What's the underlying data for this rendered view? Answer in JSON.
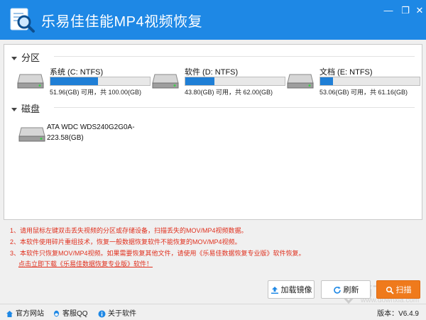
{
  "app": {
    "title": "乐易佳佳能MP4视频恢复",
    "minimize_glyph": "—",
    "restore_glyph": "❐",
    "close_glyph": "✕"
  },
  "partitions": {
    "header": "分区",
    "items": [
      {
        "name": "系统 (C: NTFS)",
        "usage": "51.96(GB) 可用，共 100.00(GB)",
        "used_fraction": 0.48
      },
      {
        "name": "软件 (D: NTFS)",
        "usage": "43.80(GB) 可用，共 62.00(GB)",
        "used_fraction": 0.29
      },
      {
        "name": "文档 (E: NTFS)",
        "usage": "53.06(GB) 可用，共 61.16(GB)",
        "used_fraction": 0.13
      }
    ]
  },
  "disks": {
    "header": "磁盘",
    "items": [
      {
        "name": "ATA WDC WDS240G2G0A-",
        "size": "223.58(GB)"
      }
    ]
  },
  "notes": [
    "1、请用鼠标左键双击丢失视频的分区或存储设备，扫描丢失的MOV/MP4视频数据。",
    "2、本软件使用碎片重组技术，恢复一般数据恢复软件不能恢复的MOV/MP4视频。",
    "3、本软件只恢复MOV/MP4视频。如果需要恢复其他文件，请使用《乐易佳数据恢复专业版》软件恢复。"
  ],
  "download_link": "点击立即下载《乐易佳数据恢复专业版》软件！",
  "buttons": {
    "load_image": "加载镜像",
    "refresh": "刷新",
    "scan": "扫描"
  },
  "footer": {
    "website": "官方网站",
    "qq": "客服QQ",
    "about": "关于软件",
    "version": "版本：V6.4.9"
  },
  "watermark": {
    "text": "当下软件园",
    "url": "www.downxia.com"
  },
  "colors": {
    "titlebar": "#1e88e5",
    "bar_fill": "#1f7fd6",
    "note_red": "#e0301e",
    "scan_orange": "#ef7a1c"
  }
}
